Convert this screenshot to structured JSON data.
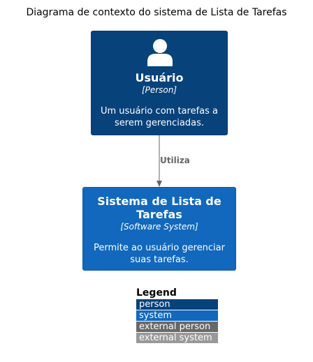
{
  "title": "Diagrama de contexto do sistema de Lista de Tarefas",
  "colors": {
    "person": "#08427b",
    "system": "#1168bd",
    "external_person": "#686868",
    "external_system": "#999999",
    "arrow": "#666666"
  },
  "nodes": {
    "person": {
      "icon": "person-icon",
      "name": "Usuário",
      "type": "[Person]",
      "description": "Um usuário com tarefas a serem gerenciadas."
    },
    "system": {
      "name": "Sistema de Lista de Tarefas",
      "type": "[Software System]",
      "description": "Permite ao usuário gerenciar suas tarefas."
    }
  },
  "relationship": {
    "label": "Utiliza"
  },
  "legend": {
    "title": "Legend",
    "items": [
      {
        "label": "person",
        "color": "#08427b"
      },
      {
        "label": "system",
        "color": "#1168bd"
      },
      {
        "label": "external person",
        "color": "#686868"
      },
      {
        "label": "external system",
        "color": "#999999"
      }
    ]
  }
}
